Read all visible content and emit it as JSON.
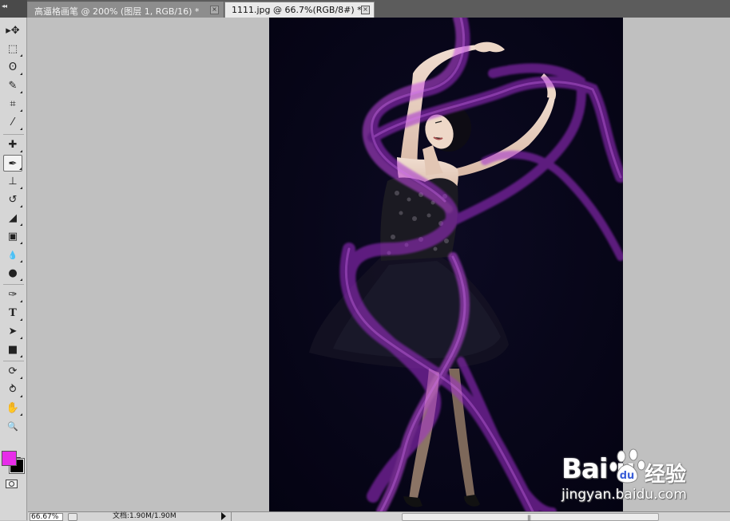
{
  "tabs": [
    {
      "label": "高逼格画笔 @ 200% (图层 1, RGB/16) *",
      "active": false
    },
    {
      "label": "1111.jpg @ 66.7%(RGB/8#) *",
      "active": true
    }
  ],
  "tab_close_glyph": "×",
  "toolbox": {
    "grip_glyph": "◂◂",
    "tools": [
      {
        "name": "move-tool",
        "icon": "move-icon",
        "glyph": "▸✥"
      },
      {
        "name": "marquee-tool",
        "icon": "rectangular-marquee-icon",
        "glyph": "⬚"
      },
      {
        "name": "lasso-tool",
        "icon": "lasso-icon",
        "glyph": "ʘ"
      },
      {
        "name": "quick-selection-tool",
        "icon": "quick-selection-icon",
        "glyph": "✎"
      },
      {
        "name": "crop-tool",
        "icon": "crop-icon",
        "glyph": "⌗"
      },
      {
        "name": "eyedropper-tool",
        "icon": "eyedropper-icon",
        "glyph": "⁄"
      },
      {
        "name": "healing-brush-tool",
        "icon": "bandage-icon",
        "glyph": "✚"
      },
      {
        "name": "brush-tool",
        "icon": "brush-icon",
        "glyph": "✒"
      },
      {
        "name": "clone-stamp-tool",
        "icon": "stamp-icon",
        "glyph": "⊥"
      },
      {
        "name": "history-brush-tool",
        "icon": "history-brush-icon",
        "glyph": "↺"
      },
      {
        "name": "eraser-tool",
        "icon": "eraser-icon",
        "glyph": "◢"
      },
      {
        "name": "gradient-tool",
        "icon": "gradient-icon",
        "glyph": "▣"
      },
      {
        "name": "blur-tool",
        "icon": "drop-icon",
        "glyph": "💧"
      },
      {
        "name": "dodge-tool",
        "icon": "dodge-icon",
        "glyph": "●"
      },
      {
        "name": "pen-tool",
        "icon": "pen-icon",
        "glyph": "✑"
      },
      {
        "name": "type-tool",
        "icon": "type-icon",
        "glyph": "T"
      },
      {
        "name": "path-selection-tool",
        "icon": "arrow-cursor-icon",
        "glyph": "➤"
      },
      {
        "name": "shape-tool",
        "icon": "rectangle-icon",
        "glyph": "■"
      },
      {
        "name": "3d-rotate-tool",
        "icon": "3d-rotate-icon",
        "glyph": "⟳"
      },
      {
        "name": "3d-orbit-tool",
        "icon": "3d-orbit-icon",
        "glyph": "⥁"
      },
      {
        "name": "hand-tool",
        "icon": "hand-icon",
        "glyph": "✋"
      },
      {
        "name": "zoom-tool",
        "icon": "magnifier-icon",
        "glyph": "🔍"
      }
    ],
    "selected_tool": "brush-tool",
    "foreground_color": "#e72de9",
    "background_color": "#000000",
    "swap_glyph": "⇆"
  },
  "document": {
    "file": "1111.jpg",
    "zoom": "66.7%"
  },
  "statusbar": {
    "zoom": "66.67%",
    "doc_info": "文档:1.90M/1.90M"
  },
  "watermark": {
    "logo": "Bai  u",
    "brand_cn": "经验",
    "url": "jingyan.baidu.com"
  },
  "colors": {
    "ribbon": "#b13ad8",
    "image_background": "#07051a",
    "workspace": "#c0c0c0"
  }
}
